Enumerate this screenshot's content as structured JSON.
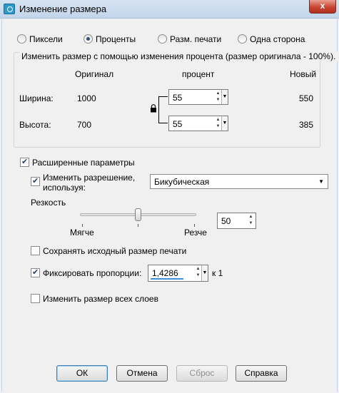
{
  "window": {
    "title": "Изменение размера",
    "close_glyph": "x"
  },
  "mode_options": [
    {
      "label": "Пиксели",
      "selected": false
    },
    {
      "label": "Проценты",
      "selected": true
    },
    {
      "label": "Разм. печати",
      "selected": false
    },
    {
      "label": "Одна сторона",
      "selected": false
    }
  ],
  "percent_group": {
    "caption": "Изменить размер с помощью изменения процента (размер оригинала - 100%).",
    "col_original": "Оригинал",
    "col_percent": "процент",
    "col_new": "Новый",
    "width": {
      "label": "Ширина:",
      "original": "1000",
      "percent": "55",
      "new": "550"
    },
    "height": {
      "label": "Высота:",
      "original": "700",
      "percent": "55",
      "new": "385"
    }
  },
  "advanced": {
    "label": "Расширенные параметры",
    "checked": true,
    "resample": {
      "label_line1": "Изменить разрешение,",
      "label_line2": "используя:",
      "checked": true,
      "method": "Бикубическая"
    },
    "sharpness": {
      "label": "Резкость",
      "value": "50",
      "min_label": "Мягче",
      "max_label": "Резче",
      "level": 50
    },
    "keep_print_size": {
      "label": "Сохранять исходный размер печати",
      "checked": false
    },
    "lock_ratio": {
      "label": "Фиксировать пропорции:",
      "checked": true,
      "value": "1,4286",
      "suffix": "к 1"
    },
    "resize_all_layers": {
      "label": "Изменить размер всех слоев",
      "checked": false
    }
  },
  "buttons": {
    "ok": "ОК",
    "cancel": "Отмена",
    "reset": "Сброс",
    "help": "Справка"
  },
  "icons": {
    "spin_up": "▲",
    "spin_down": "▼",
    "dropdown": "▼"
  }
}
